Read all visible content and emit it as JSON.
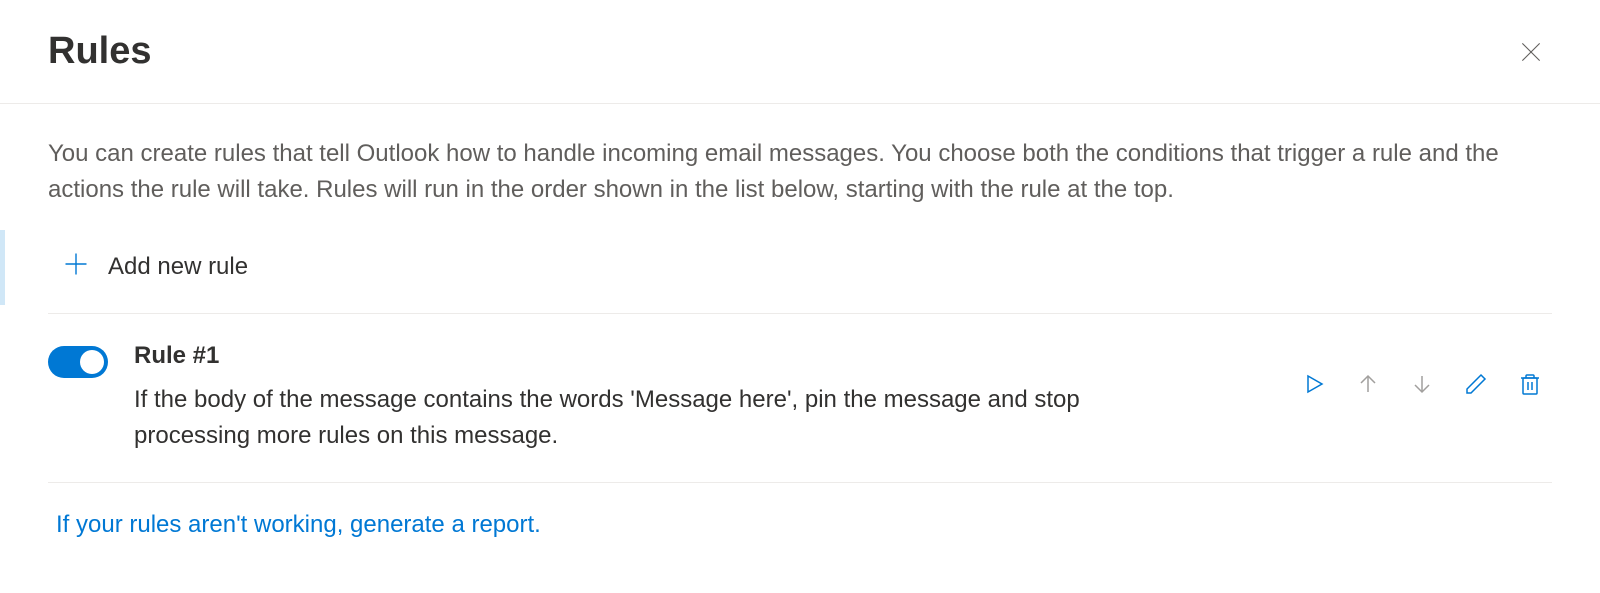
{
  "header": {
    "title": "Rules"
  },
  "description": "You can create rules that tell Outlook how to handle incoming email messages. You choose both the conditions that trigger a rule and the actions the rule will take. Rules will run in the order shown in the list below, starting with the rule at the top.",
  "addRule": {
    "label": "Add new rule"
  },
  "rules": [
    {
      "enabled": true,
      "title": "Rule #1",
      "description": "If the body of the message contains the words 'Message here', pin the message and stop processing more rules on this message."
    }
  ],
  "reportLink": "If your rules aren't working, generate a report."
}
